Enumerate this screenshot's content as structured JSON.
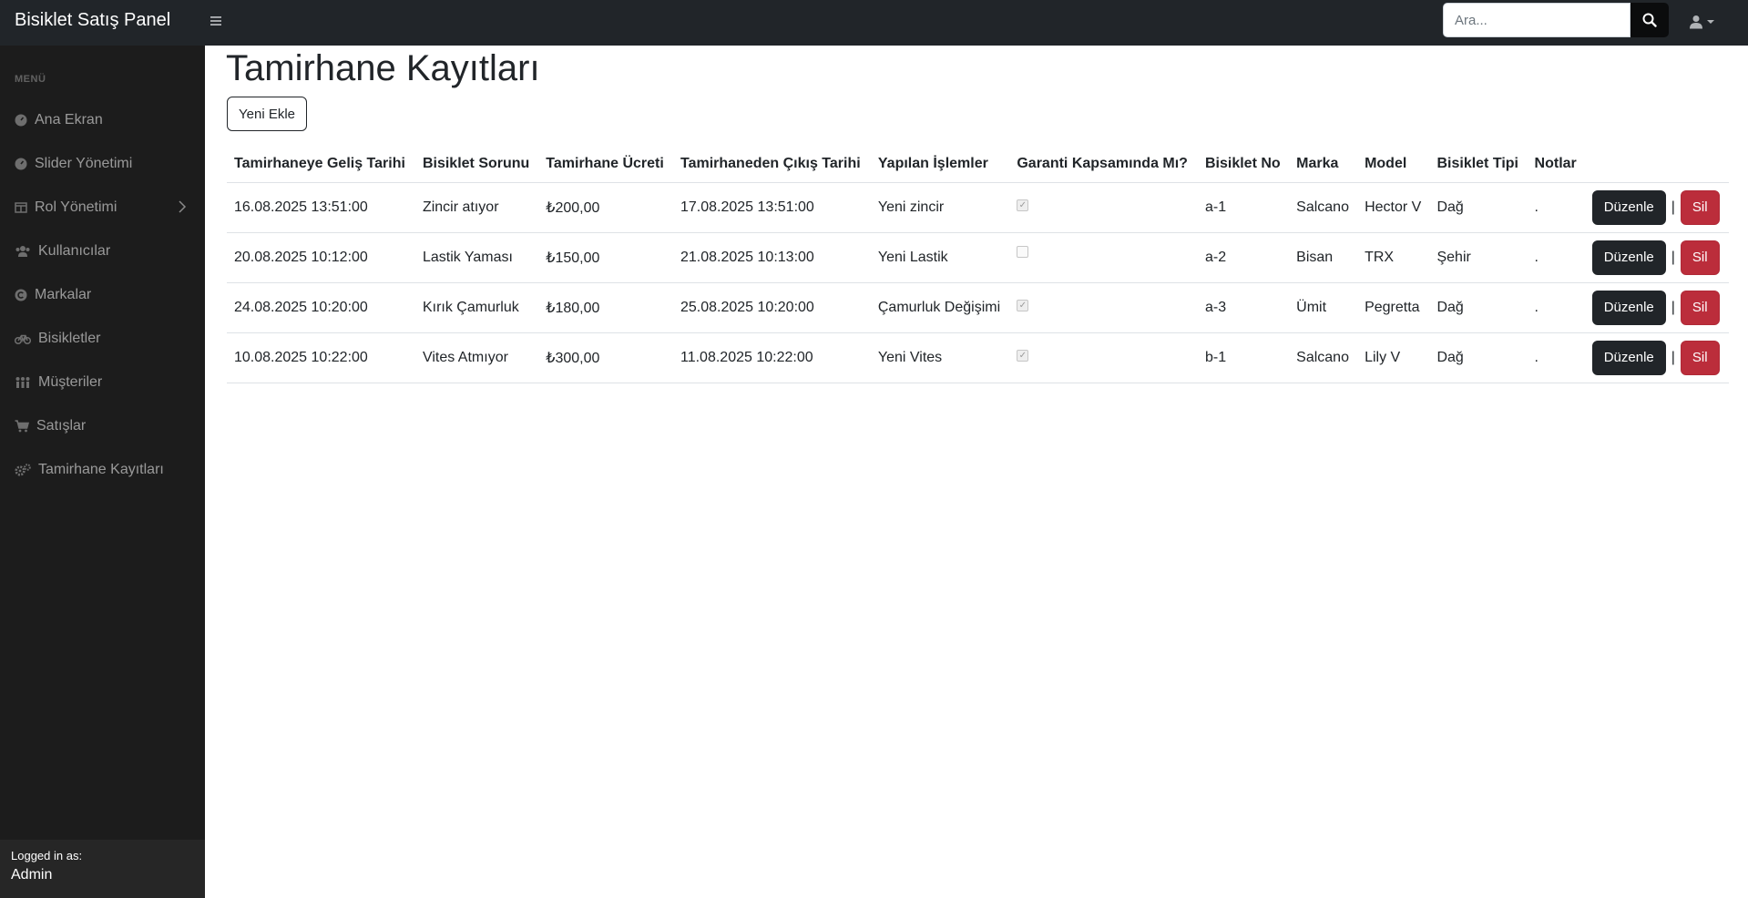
{
  "brand": "Bisiklet Satış Panel",
  "search": {
    "placeholder": "Ara..."
  },
  "sidebar": {
    "heading": "MENÜ",
    "items": [
      {
        "label": "Ana Ekran",
        "icon": "gauge-icon"
      },
      {
        "label": "Slider Yönetimi",
        "icon": "gauge-icon"
      },
      {
        "label": "Rol Yönetimi",
        "icon": "columns-icon"
      },
      {
        "label": "Kullanıcılar",
        "icon": "users-icon"
      },
      {
        "label": "Markalar",
        "icon": "copyright-icon"
      },
      {
        "label": "Bisikletler",
        "icon": "bicycle-icon"
      },
      {
        "label": "Müşteriler",
        "icon": "people-group-icon"
      },
      {
        "label": "Satışlar",
        "icon": "cart-icon"
      },
      {
        "label": "Tamirhane Kayıtları",
        "icon": "gears-icon"
      }
    ],
    "footer": {
      "label": "Logged in as:",
      "user": "Admin"
    }
  },
  "page": {
    "title": "Tamirhane Kayıtları",
    "add_button": "Yeni Ekle"
  },
  "table": {
    "headers": [
      "Tamirhaneye Geliş Tarihi",
      "Bisiklet Sorunu",
      "Tamirhane Ücreti",
      "Tamirhaneden Çıkış Tarihi",
      "Yapılan İşlemler",
      "Garanti Kapsamında Mı?",
      "Bisiklet No",
      "Marka",
      "Model",
      "Bisiklet Tipi",
      "Notlar"
    ],
    "edit_label": "Düzenle",
    "delete_label": "Sil",
    "separator": "|",
    "rows": [
      {
        "arrival": "16.08.2025 13:51:00",
        "problem": "Zincir atıyor",
        "fee": "₺200,00",
        "departure": "17.08.2025 13:51:00",
        "work": "Yeni zincir",
        "warranty": true,
        "bike_no": "a-1",
        "brand": "Salcano",
        "model": "Hector V",
        "type": "Dağ",
        "notes": "."
      },
      {
        "arrival": "20.08.2025 10:12:00",
        "problem": "Lastik Yaması",
        "fee": "₺150,00",
        "departure": "21.08.2025 10:13:00",
        "work": "Yeni Lastik",
        "warranty": false,
        "bike_no": "a-2",
        "brand": "Bisan",
        "model": "TRX",
        "type": "Şehir",
        "notes": "."
      },
      {
        "arrival": "24.08.2025 10:20:00",
        "problem": "Kırık Çamurluk",
        "fee": "₺180,00",
        "departure": "25.08.2025 10:20:00",
        "work": "Çamurluk Değişimi",
        "warranty": true,
        "bike_no": "a-3",
        "brand": "Ümit",
        "model": "Pegretta",
        "type": "Dağ",
        "notes": "."
      },
      {
        "arrival": "10.08.2025 10:22:00",
        "problem": "Vites Atmıyor",
        "fee": "₺300,00",
        "departure": "11.08.2025 10:22:00",
        "work": "Yeni Vites",
        "warranty": true,
        "bike_no": "b-1",
        "brand": "Salcano",
        "model": "Lily V",
        "type": "Dağ",
        "notes": "."
      }
    ]
  },
  "colors": {
    "topbar": "#212529",
    "sidebar": "#1c1c1c",
    "edit": "#212529",
    "delete": "#bb2d3b"
  }
}
